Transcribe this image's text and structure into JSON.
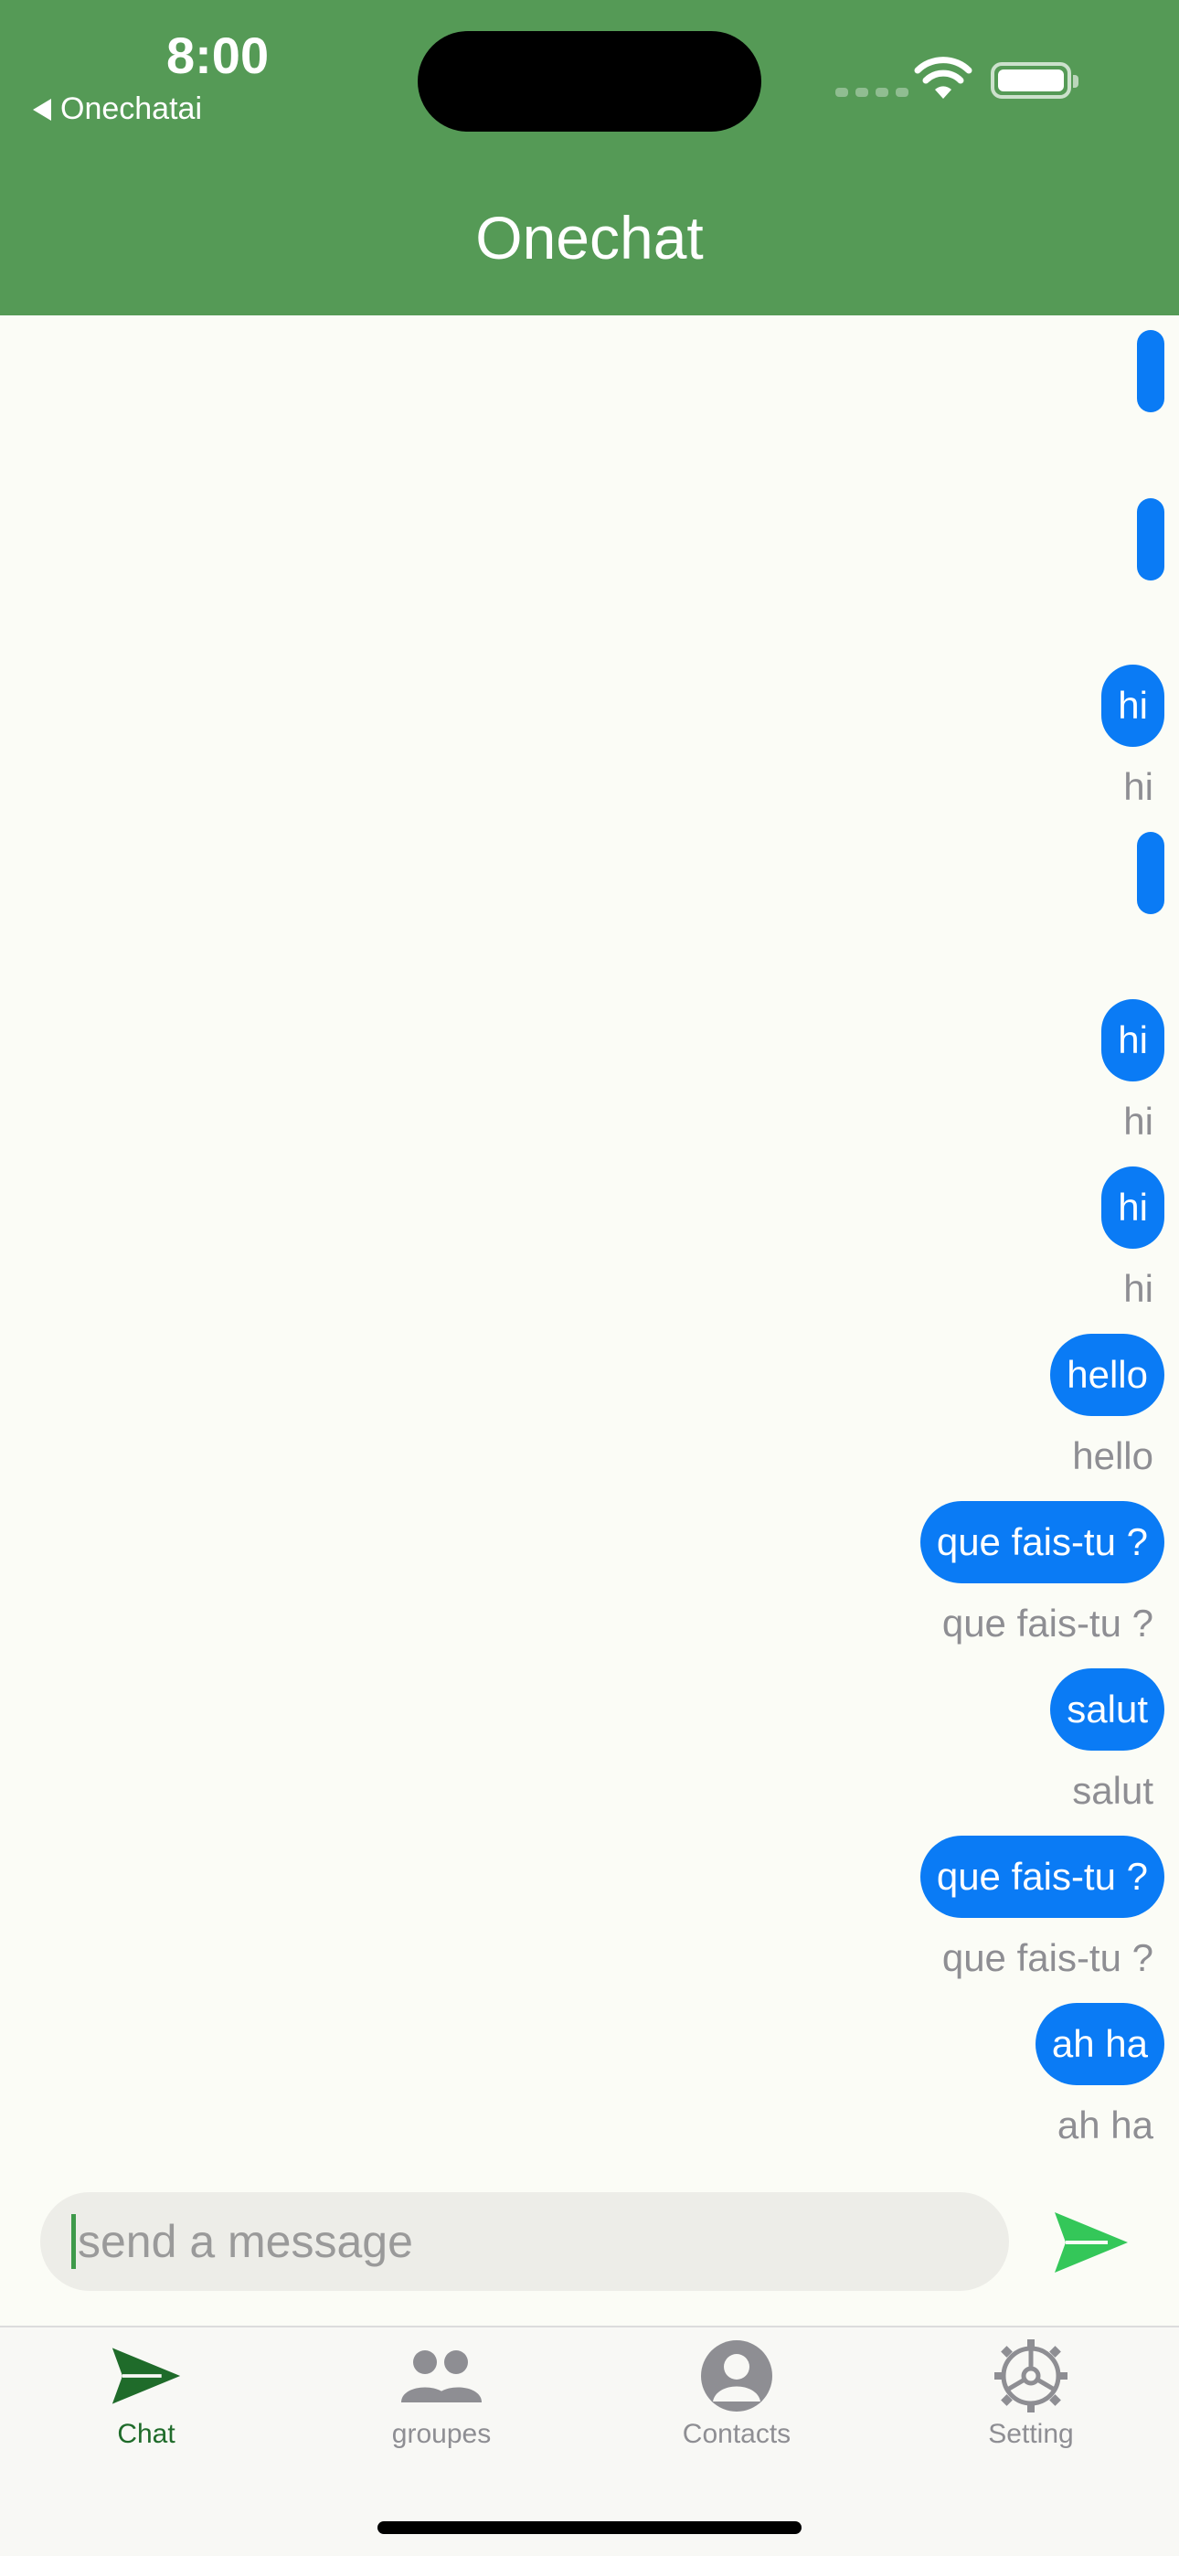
{
  "status_bar": {
    "time": "8:00",
    "back_label": "Onechatai"
  },
  "header": {
    "title": "Onechat"
  },
  "colors": {
    "header_green": "#559a56",
    "bubble_blue": "#0a7bf5",
    "send_green": "#34c759",
    "active_tab": "#1f6b2a"
  },
  "messages": [
    {
      "text": "",
      "caption": ""
    },
    {
      "text": "",
      "caption": ""
    },
    {
      "text": "hi",
      "caption": "hi"
    },
    {
      "text": "",
      "caption": ""
    },
    {
      "text": "hi",
      "caption": "hi"
    },
    {
      "text": "hi",
      "caption": "hi"
    },
    {
      "text": "hello",
      "caption": "hello"
    },
    {
      "text": "que fais-tu ?",
      "caption": "que fais-tu ?"
    },
    {
      "text": "salut",
      "caption": "salut"
    },
    {
      "text": "que fais-tu ?",
      "caption": "que fais-tu ?"
    },
    {
      "text": "ah ha",
      "caption": "ah ha"
    }
  ],
  "composer": {
    "placeholder": "send a message",
    "send_icon": "send-icon"
  },
  "tabs": [
    {
      "label": "Chat",
      "icon": "send-icon",
      "active": true
    },
    {
      "label": "groupes",
      "icon": "people-icon",
      "active": false
    },
    {
      "label": "Contacts",
      "icon": "person-icon",
      "active": false
    },
    {
      "label": "Setting",
      "icon": "gear-icon",
      "active": false
    }
  ]
}
